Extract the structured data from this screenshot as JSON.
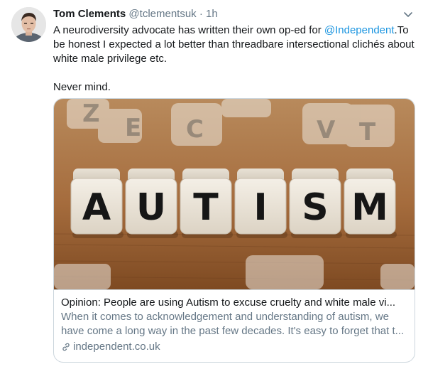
{
  "tweet": {
    "author": {
      "name": "Tom Clements",
      "handle": "@tclementsuk",
      "separator": "·",
      "time": "1h"
    },
    "text": {
      "line_pre": "A neurodiversity advocate has written their own op-ed for ",
      "mention": "@Independent",
      "line_post": ".To be honest I expected a lot better than threadbare intersectional clichés about white male privilege etc.",
      "para2": "Never mind."
    },
    "card": {
      "image_letters": [
        "A",
        "U",
        "T",
        "I",
        "S",
        "M"
      ],
      "title": "Opinion: People are using Autism to excuse cruelty and white male vi...",
      "description": "When it comes to acknowledgement and understanding of autism, we have come a long way in the past few decades. It's easy to forget that t...",
      "domain": "independent.co.uk"
    }
  },
  "icons": {
    "caret": "chevron-down-icon",
    "link": "link-icon"
  },
  "colors": {
    "link": "#1b95e0",
    "secondary_text": "#657786",
    "border": "#ccd6dd"
  }
}
